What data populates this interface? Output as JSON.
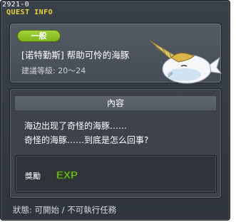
{
  "window": {
    "quest_id": "2921-0",
    "title": "QUEST INFO"
  },
  "header": {
    "category": "一般",
    "quest_name": "[诺特勤斯] 帮助可怜的海豚",
    "level": "建議等級: 20〜24",
    "mascot_icon": "narwhal-icon"
  },
  "content": {
    "heading": "內容",
    "description": [
      "海边出现了奇怪的海豚……",
      "奇怪的海豚……到底是怎么回事?"
    ]
  },
  "reward": {
    "label": "獎勵",
    "exp_label": "EXP",
    "exp_icon": "exp-icon"
  },
  "status": "狀態: 可開始 / 不可執行任務",
  "colors": {
    "title": "#e8d23c",
    "badge": "#8fc02a",
    "exp": "#9be03a"
  }
}
